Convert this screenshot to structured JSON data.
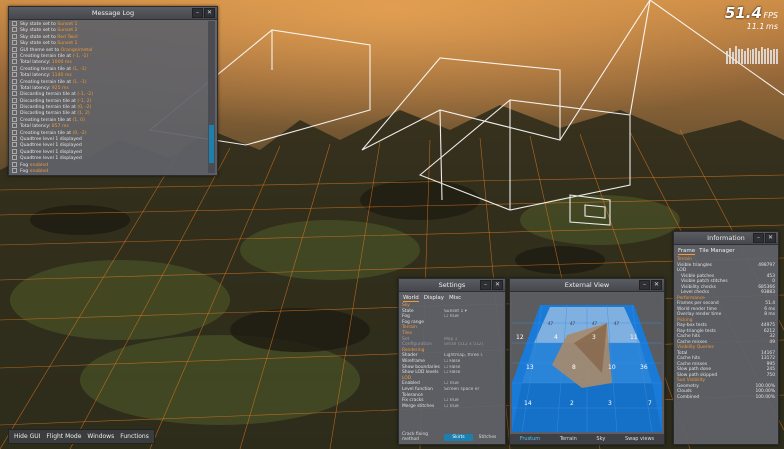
{
  "log": {
    "title": "Message Log",
    "lines": [
      {
        "text": "Sky state set to ",
        "hl": "Sunset 1"
      },
      {
        "text": "Sky state set to ",
        "hl": "Sunset 2"
      },
      {
        "text": "Sky state set to ",
        "hl": "Red Twirl"
      },
      {
        "text": "Sky state set to ",
        "hl": "Sunset 1"
      },
      {
        "text": "GUI theme set to ",
        "hl": "Orange/metal"
      },
      {
        "text": "Creating terrain tile at ",
        "hl": "(-1, -1)"
      },
      {
        "text": "Total latency: ",
        "hl": "1000 ms"
      },
      {
        "text": "Creating terrain tile at ",
        "hl": "(1, -1)"
      },
      {
        "text": "Total latency: ",
        "hl": "1140 ms"
      },
      {
        "text": "Creating terrain tile at ",
        "hl": "(1, -1)"
      },
      {
        "text": "Total latency: ",
        "hl": "925 ms"
      },
      {
        "text": "Discarding terrain tile at ",
        "hl": "(-1, -2)"
      },
      {
        "text": "Discarding terrain tile at ",
        "hl": "(-1, 2)"
      },
      {
        "text": "Discarding terrain tile at ",
        "hl": "(0, -2)"
      },
      {
        "text": "Discarding terrain tile at ",
        "hl": "(1, 2)"
      },
      {
        "text": "Creating terrain tile at ",
        "hl": "(1, 0)"
      },
      {
        "text": "Total latency: ",
        "hl": "857 ms"
      },
      {
        "text": "Creating terrain tile at ",
        "hl": "(0, -2)"
      },
      {
        "text": "Quadtree level 1 displayed",
        "hl": ""
      },
      {
        "text": "Quadtree level 1 displayed",
        "hl": ""
      },
      {
        "text": "Quadtree level 1 displayed",
        "hl": ""
      },
      {
        "text": "Quadtree level 1 displayed",
        "hl": ""
      },
      {
        "text": "Fog ",
        "hl": "enabled"
      },
      {
        "text": "Fog ",
        "hl": "enabled"
      }
    ]
  },
  "fps": {
    "value": "51.4",
    "unit": "FPS",
    "ms": "11.1",
    "ms_unit": "ms",
    "history": [
      60,
      72,
      55,
      80,
      66,
      70,
      58,
      75,
      64,
      69,
      72,
      61,
      78,
      68,
      74,
      63,
      70,
      66
    ]
  },
  "settings": {
    "title": "Settings",
    "tabs": [
      "World",
      "Display",
      "Misc"
    ],
    "rows": [
      {
        "k": "Sky",
        "v": "",
        "type": "sec"
      },
      {
        "k": "State",
        "v": "Sunset 1 ▾",
        "type": ""
      },
      {
        "k": "Fog",
        "v": "☐ True",
        "type": ""
      },
      {
        "k": "Fog range",
        "v": "",
        "type": ""
      },
      {
        "k": "Terrain",
        "v": "",
        "type": "sec"
      },
      {
        "k": "Tiles",
        "v": "",
        "type": "sec"
      },
      {
        "k": "Set",
        "v": "Map 1",
        "type": "dim"
      },
      {
        "k": "Configuration",
        "v": "Small (512 x 512)",
        "type": "dim"
      },
      {
        "k": "Rendering",
        "v": "",
        "type": "sec"
      },
      {
        "k": "Shader",
        "v": "Lightmap, three l.",
        "type": ""
      },
      {
        "k": "Wireframe",
        "v": "☐ False",
        "type": ""
      },
      {
        "k": "Show boundaries",
        "v": "☐ False",
        "type": ""
      },
      {
        "k": "Show LOD levels",
        "v": "☐ False",
        "type": ""
      },
      {
        "k": "LOD",
        "v": "",
        "type": "sec"
      },
      {
        "k": "Enabled",
        "v": "☐ True",
        "type": ""
      },
      {
        "k": "Level function",
        "v": "Screen space er",
        "type": ""
      },
      {
        "k": "Tolerance",
        "v": "",
        "type": ""
      },
      {
        "k": "Fix cracks",
        "v": "☐ True",
        "type": ""
      },
      {
        "k": "Merge stitches",
        "v": "☐ True",
        "type": ""
      }
    ],
    "bottom_label": "Crack fixing method",
    "bottom_opt1": "Skirts",
    "bottom_opt2": "Stitches"
  },
  "ext": {
    "title": "External View",
    "tabs": [
      "Frustum",
      "Terrain",
      "Sky",
      "Swap views"
    ],
    "labels": [
      "12",
      "4",
      "3",
      "11",
      "13",
      "8",
      "10",
      "36",
      "14",
      "2",
      "3",
      "7",
      "47",
      "47",
      "47",
      "47"
    ]
  },
  "info": {
    "title": "Information",
    "tabs": [
      "Frame",
      "Tile Manager"
    ],
    "rows": [
      {
        "k": "Terrain",
        "v": "",
        "type": "sec"
      },
      {
        "k": "Visible triangles",
        "v": "498797",
        "type": ""
      },
      {
        "k": "LOD",
        "v": "",
        "type": ""
      },
      {
        "k": "Visible patches",
        "v": "453",
        "type": "ind"
      },
      {
        "k": "Visible patch stitches",
        "v": "0",
        "type": "ind"
      },
      {
        "k": "Visibility checks",
        "v": "685366",
        "type": "ind"
      },
      {
        "k": "Level checks",
        "v": "93883",
        "type": "ind"
      },
      {
        "k": "Performance",
        "v": "",
        "type": "sec"
      },
      {
        "k": "Frames per second",
        "v": "51.4",
        "type": ""
      },
      {
        "k": "World render time",
        "v": "6 ms",
        "type": ""
      },
      {
        "k": "Overlay render time",
        "v": "8 ms",
        "type": ""
      },
      {
        "k": "Picking",
        "v": "",
        "type": "sec"
      },
      {
        "k": "Ray-box tests",
        "v": "44975",
        "type": ""
      },
      {
        "k": "Ray-triangle tests",
        "v": "6212",
        "type": ""
      },
      {
        "k": "Cache hits",
        "v": "32",
        "type": ""
      },
      {
        "k": "Cache misses",
        "v": "49",
        "type": ""
      },
      {
        "k": "Visibility Queries",
        "v": "",
        "type": "sec"
      },
      {
        "k": "Total",
        "v": "14167",
        "type": ""
      },
      {
        "k": "Cache hits",
        "v": "13172",
        "type": ""
      },
      {
        "k": "Cache misses",
        "v": "995",
        "type": ""
      },
      {
        "k": "Slow path done",
        "v": "245",
        "type": ""
      },
      {
        "k": "Slow path skipped",
        "v": "750",
        "type": ""
      },
      {
        "k": "Sun Visibility",
        "v": "",
        "type": "sec"
      },
      {
        "k": "Geometry",
        "v": "100.00%",
        "type": ""
      },
      {
        "k": "Clouds",
        "v": "100.00%",
        "type": ""
      },
      {
        "k": "Combined",
        "v": "100.00%",
        "type": ""
      }
    ]
  },
  "bottombar": {
    "items": [
      "Hide GUI",
      "Flight Mode",
      "Windows",
      "Functions"
    ]
  },
  "colors": {
    "accent": "#f09a3a",
    "selection": "#1c7fae",
    "panel": "#606268"
  }
}
